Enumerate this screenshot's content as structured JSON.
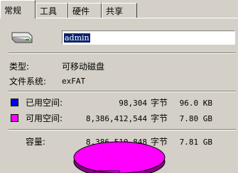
{
  "tabs": [
    "常规",
    "工具",
    "硬件",
    "共享"
  ],
  "drive_name": "admin",
  "type_label": "类型:",
  "type_value": "可移动磁盘",
  "fs_label": "文件系统:",
  "fs_value": "exFAT",
  "used": {
    "label": "已用空间:",
    "bytes": "98,304",
    "unit": "字节",
    "size": "96.0 KB",
    "color": "#0000ff"
  },
  "free": {
    "label": "可用空间:",
    "bytes": "8,386,412,544",
    "unit": "字节",
    "size": "7.80 GB",
    "color": "#ff00ff"
  },
  "capacity": {
    "label": "容量:",
    "bytes": "8,386,510,848",
    "unit": "字节",
    "size": "7.81 GB"
  },
  "colors": {
    "pie_free": "#ff00ff",
    "pie_shadow": "#800080",
    "pie_used": "#0000ff"
  }
}
